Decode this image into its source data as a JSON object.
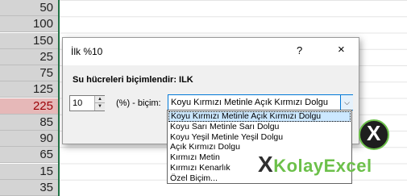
{
  "spreadsheet": {
    "cells": [
      {
        "value": "50",
        "highlight": false
      },
      {
        "value": "100",
        "highlight": false
      },
      {
        "value": "150",
        "highlight": false
      },
      {
        "value": "25",
        "highlight": false
      },
      {
        "value": "75",
        "highlight": false
      },
      {
        "value": "125",
        "highlight": false
      },
      {
        "value": "225",
        "highlight": true
      },
      {
        "value": "85",
        "highlight": false
      },
      {
        "value": "90",
        "highlight": false
      },
      {
        "value": "65",
        "highlight": false
      },
      {
        "value": "15",
        "highlight": false
      },
      {
        "value": "35",
        "highlight": false
      }
    ]
  },
  "dialog": {
    "title": "İlk %10",
    "help_glyph": "?",
    "close_glyph": "×",
    "instruction": "Su hücreleri biçimlendir: ILK",
    "count_value": "10",
    "label": "(%) - biçim:",
    "format_selected": "Koyu Kırmızı Metinle Açık Kırmızı Dolgu",
    "dropdown_options": [
      "Koyu Kırmızı Metinle Açık Kırmızı Dolgu",
      "Koyu Sarı Metinle Sarı Dolgu",
      "Koyu Yeşil Metinle Yeşil Dolgu",
      "Açık Kırmızı Dolgu",
      "Kırmızı Metin",
      "Kırmızı Kenarlık",
      "Özel Biçim..."
    ]
  },
  "watermark": {
    "prefix": "X",
    "text": "KolayExcel",
    "logo_glyph": "X"
  },
  "colors": {
    "accent_green": "#217346",
    "highlight_fill": "#e6b8b8",
    "highlight_text": "#9c0006",
    "brand_green": "#6cc04a"
  }
}
